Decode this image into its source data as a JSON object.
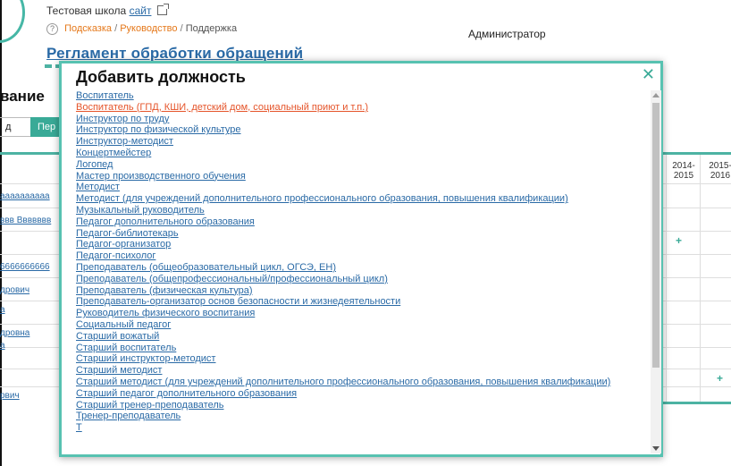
{
  "school": {
    "name": "Тестовая школа",
    "site_link": "сайт"
  },
  "help": {
    "hint": "Подсказка",
    "sep1": "/",
    "guide": "Руководство",
    "sep2": "/",
    "support": "Поддержка"
  },
  "user_role": "Администратор",
  "page_title": "Регламент обработки обращений",
  "section_word": "вание",
  "tabs": {
    "first": "д",
    "second": "Пер"
  },
  "table": {
    "years": [
      "2014-\n2015",
      "2015-\n2016"
    ],
    "left_cells": [
      "аааааааааа",
      "ввв Ввввввв",
      "",
      "6666666666",
      "дрович",
      "а",
      "дровна",
      "а",
      "",
      "рвич"
    ]
  },
  "modal": {
    "title": "Добавить должность",
    "close_glyph": "✕",
    "positions": [
      "Воспитатель",
      "Воспитатель (ГПД, КШИ, детский дом, социальный приют и т.п.)",
      "Инструктор по труду",
      "Инструктор по физической культуре",
      "Инструктор-методист",
      "Концертмейстер",
      "Логопед",
      "Мастер производственного обучения",
      "Методист",
      "Методист (для учреждений дополнительного профессионального образования, повышения квалификации)",
      "Музыкальный руководитель",
      "Педагог дополнительного образования",
      "Педагог-библиотекарь",
      "Педагог-организатор",
      "Педагог-психолог",
      "Преподаватель (общеобразовательный цикл, ОГСЭ, ЕН)",
      "Преподаватель (общепрофессиональный/профессиональный цикл)",
      "Преподаватель (физическая культура)",
      "Преподаватель-организатор основ безопасности и жизнедеятельности",
      "Руководитель физического воспитания",
      "Социальный педагог",
      "Старший вожатый",
      "Старший воспитатель",
      "Старший инструктор-методист",
      "Старший методист",
      "Старший методист (для учреждений дополнительного профессионального образования, повышения квалификации)",
      "Старший педагог дополнительного образования",
      "Старший тренер-преподаватель",
      "Тренер-преподаватель",
      "Т"
    ]
  },
  "colors": {
    "accent": "#4db3a3",
    "link": "#2a6aa6",
    "highlight": "#e5542a",
    "orange": "#e5781a"
  },
  "icons": {
    "help": "help-circle-icon",
    "external": "external-link-icon",
    "close": "close-icon",
    "plus": "plus-icon"
  }
}
